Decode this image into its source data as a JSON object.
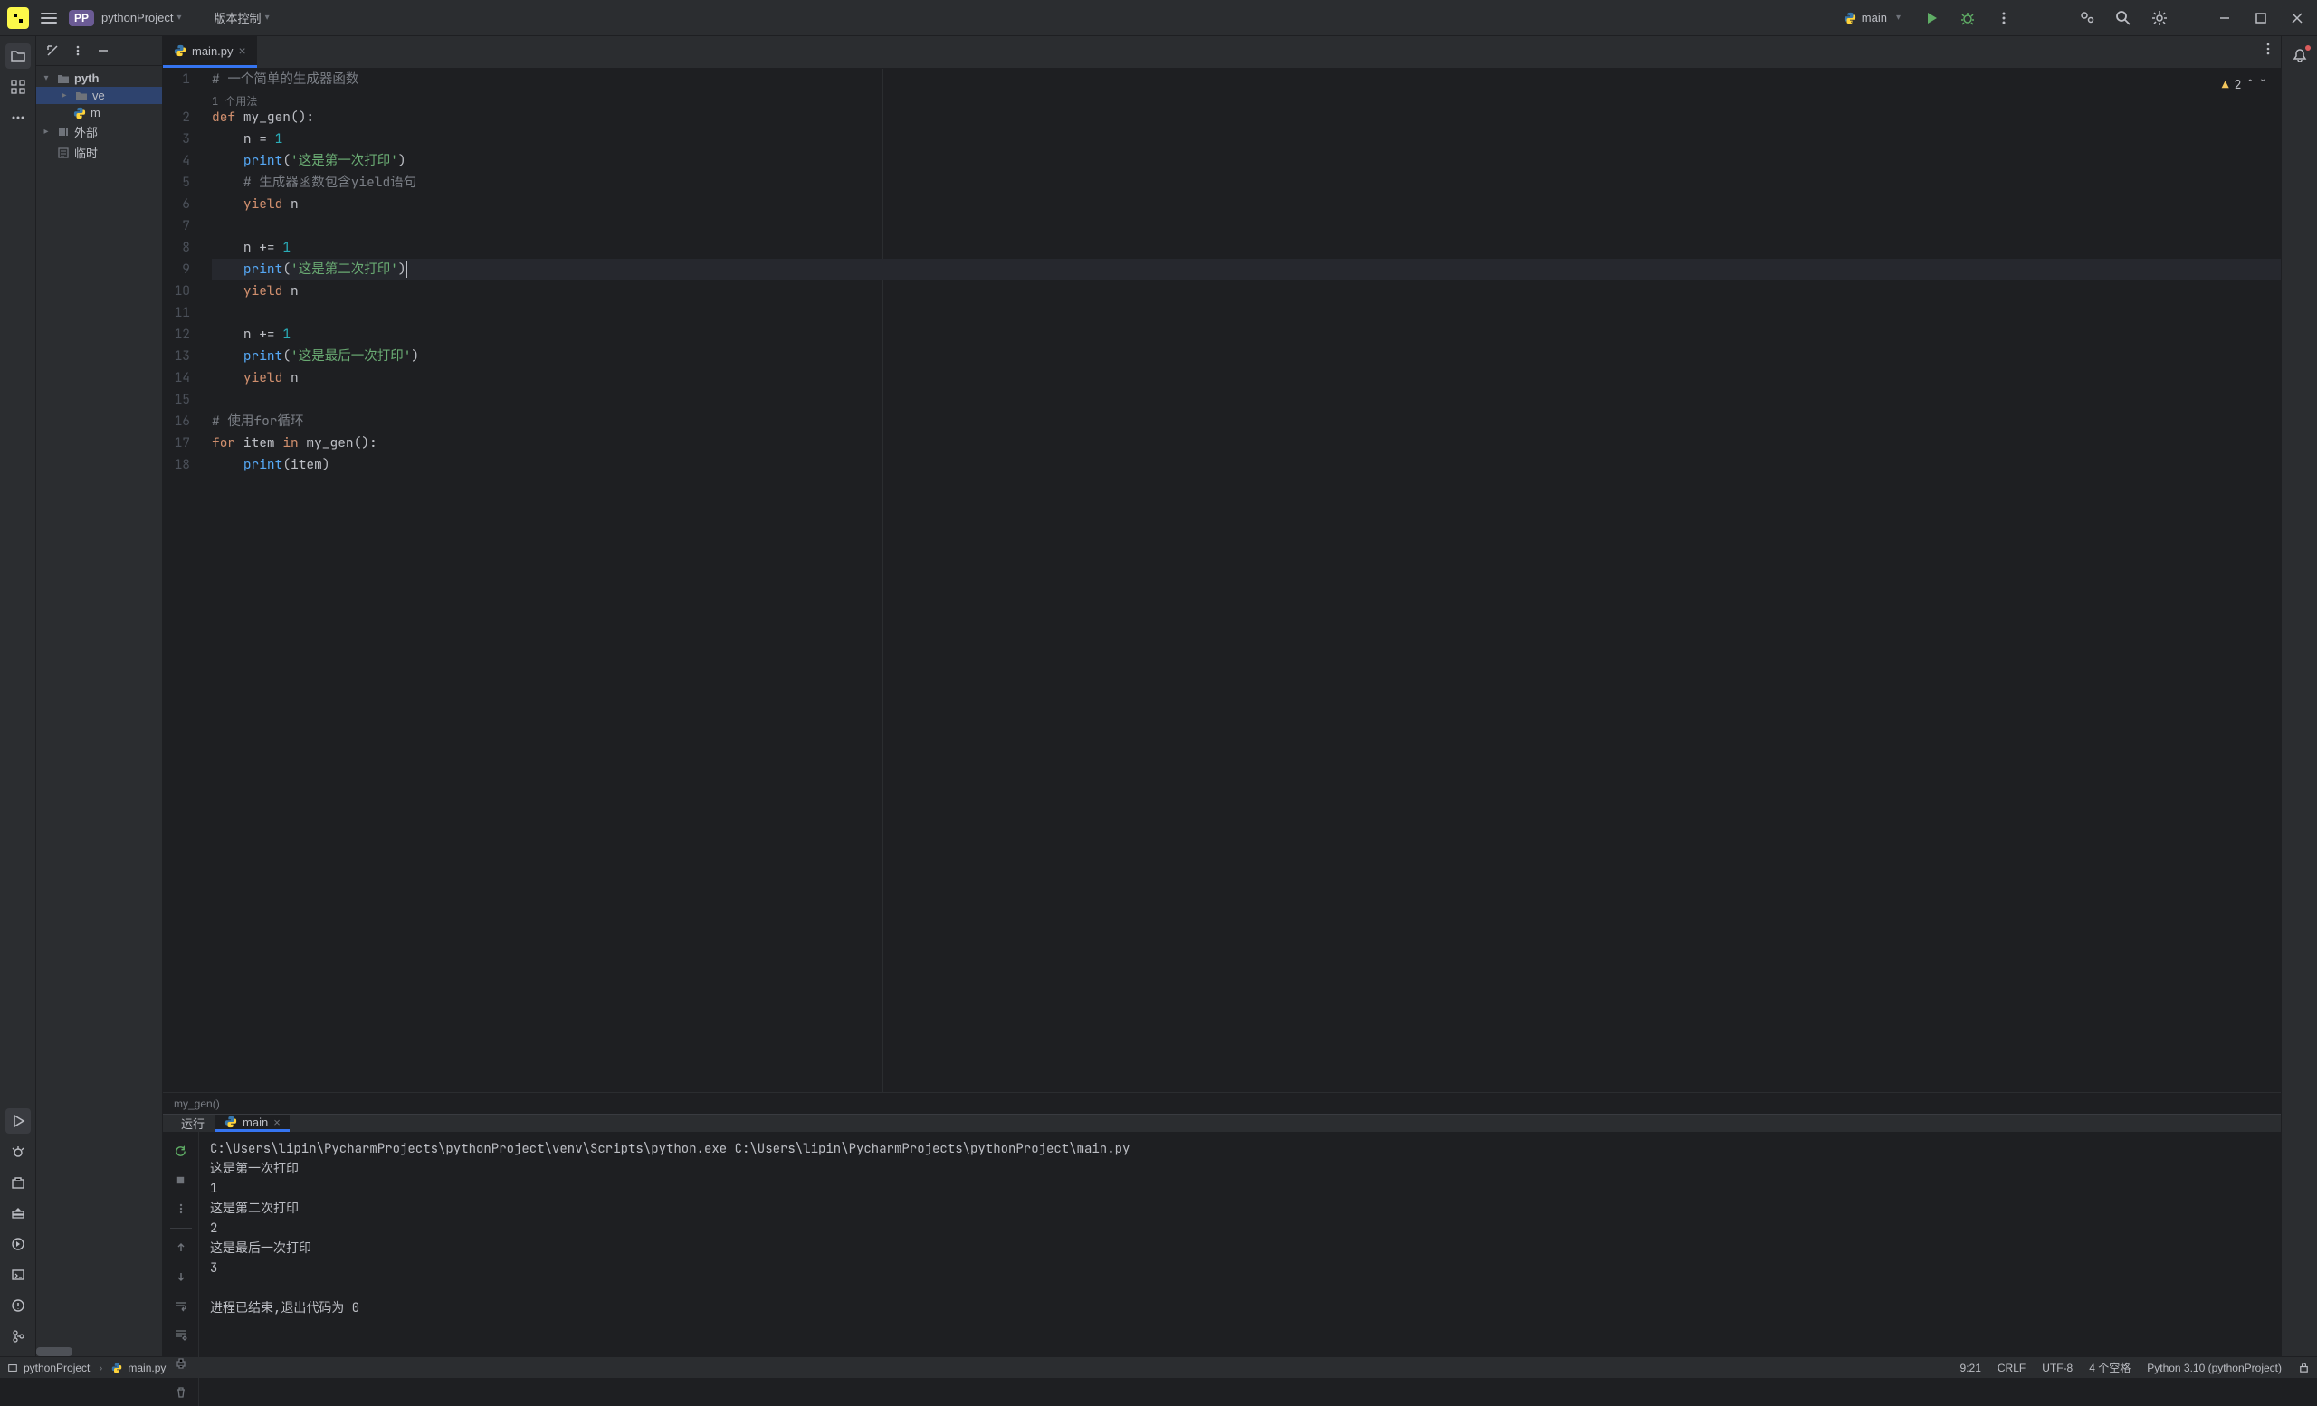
{
  "titlebar": {
    "project": "pythonProject",
    "projectBadge": "PP",
    "vcs": "版本控制",
    "runConfig": "main"
  },
  "sidebar": {
    "tree": {
      "root": "pyth",
      "venv": "ve",
      "mainpy": "m",
      "external": "外部",
      "scratch": "临时"
    }
  },
  "editor": {
    "tab": "main.py",
    "warnCount": "2",
    "usageInlay": "1 个用法",
    "breadcrumb": "my_gen()",
    "lines": {
      "l1_comment": "# 一个简单的生成器函数",
      "l2_def": "def",
      "l2_name": "my_gen",
      "l2_paren": "():",
      "l3_var": "n",
      "l3_eq": " = ",
      "l3_val": "1",
      "l4_print": "print",
      "l4_open": "(",
      "l4_str": "'这是第一次打印'",
      "l4_close": ")",
      "l5_comment": "# 生成器函数包含yield语句",
      "l6_yield": "yield",
      "l6_var": " n",
      "l8_var": "n",
      "l8_op": " += ",
      "l8_val": "1",
      "l9_print": "print",
      "l9_open": "(",
      "l9_str": "'这是第二次打印'",
      "l9_close": ")",
      "l10_yield": "yield",
      "l10_var": " n",
      "l12_var": "n",
      "l12_op": " += ",
      "l12_val": "1",
      "l13_print": "print",
      "l13_open": "(",
      "l13_str": "'这是最后一次打印'",
      "l13_close": ")",
      "l14_yield": "yield",
      "l14_var": " n",
      "l16_comment": "# 使用for循环",
      "l17_for": "for",
      "l17_item": " item ",
      "l17_in": "in",
      "l17_call": " my_gen",
      "l17_paren": "():",
      "l18_print": "print",
      "l18_open": "(",
      "l18_arg": "item",
      "l18_close": ")"
    },
    "lineNumbers": [
      "1",
      "2",
      "3",
      "4",
      "5",
      "6",
      "7",
      "8",
      "9",
      "10",
      "11",
      "12",
      "13",
      "14",
      "15",
      "16",
      "17",
      "18"
    ]
  },
  "run": {
    "label": "运行",
    "tab": "main",
    "output": [
      "C:\\Users\\lipin\\PycharmProjects\\pythonProject\\venv\\Scripts\\python.exe C:\\Users\\lipin\\PycharmProjects\\pythonProject\\main.py",
      "这是第一次打印",
      "1",
      "这是第二次打印",
      "2",
      "这是最后一次打印",
      "3",
      "",
      "进程已结束,退出代码为 0"
    ]
  },
  "statusbar": {
    "project": "pythonProject",
    "file": "main.py",
    "pos": "9:21",
    "lineEnding": "CRLF",
    "encoding": "UTF-8",
    "indent": "4 个空格",
    "interpreter": "Python 3.10 (pythonProject)"
  }
}
